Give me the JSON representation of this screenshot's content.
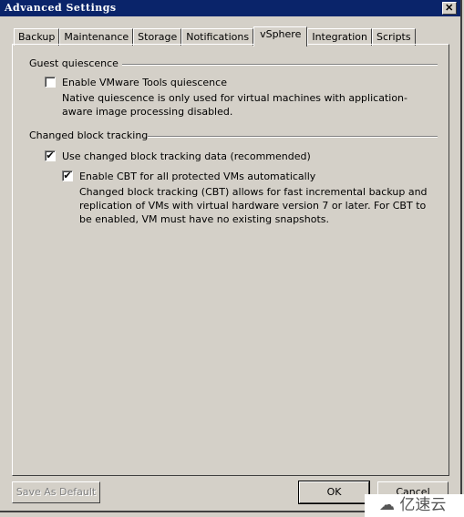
{
  "window": {
    "title": "Advanced Settings",
    "close_label": "✕"
  },
  "tabs": [
    {
      "label": "Backup"
    },
    {
      "label": "Maintenance"
    },
    {
      "label": "Storage"
    },
    {
      "label": "Notifications"
    },
    {
      "label": "vSphere",
      "active": true
    },
    {
      "label": "Integration"
    },
    {
      "label": "Scripts"
    }
  ],
  "guest": {
    "header": "Guest quiescence",
    "vmware_tools": {
      "label": "Enable VMware Tools quiescence",
      "checked": false,
      "description": "Native quiescence is only used for virtual machines with application-aware image processing disabled."
    }
  },
  "cbt": {
    "header": "Changed block tracking",
    "use_cbt": {
      "label": "Use changed block tracking data (recommended)",
      "checked": true
    },
    "enable_cbt": {
      "label": "Enable CBT for all protected VMs automatically",
      "checked": true,
      "description": "Changed block tracking (CBT) allows for fast incremental backup and replication of VMs with virtual hardware version 7 or later. For CBT to be enabled, VM must have no existing snapshots."
    }
  },
  "buttons": {
    "save_default": "Save As Default",
    "ok": "OK",
    "cancel": "Cancel"
  },
  "check_glyph": "✔",
  "watermark": "亿速云"
}
